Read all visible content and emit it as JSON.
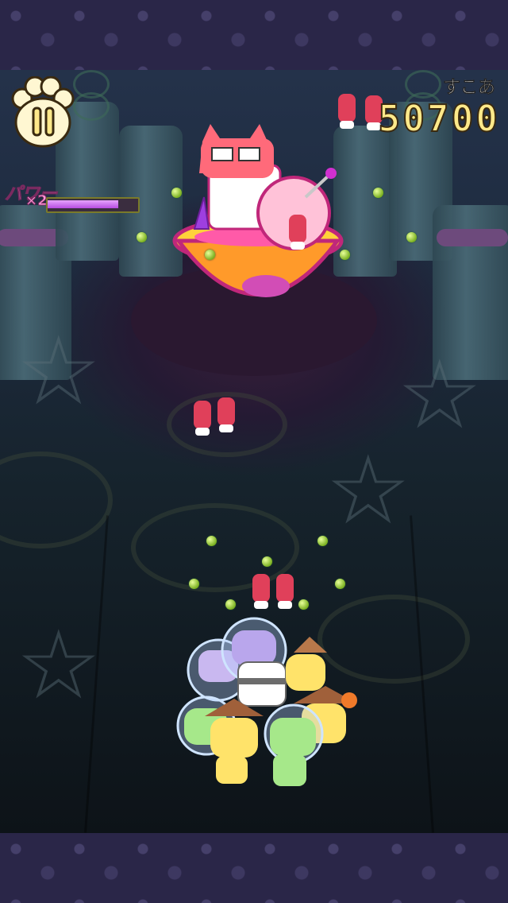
{
  "hud": {
    "score_label": "すこあ",
    "score_value": "50700",
    "power_label": "パワー",
    "power_multiplier": "×2",
    "power_level": 0.78
  },
  "icons": {
    "pause": "paw-pause-icon",
    "boss": "scientist-cat-boss",
    "player": "cat-squad",
    "projectile": "tuna-sushi-projectile",
    "pellet": "green-pellet"
  },
  "colors": {
    "score": "#ffe98a",
    "power": "#ff9ad8",
    "pellet": "#7ab020",
    "sushi": "#e0405a"
  }
}
